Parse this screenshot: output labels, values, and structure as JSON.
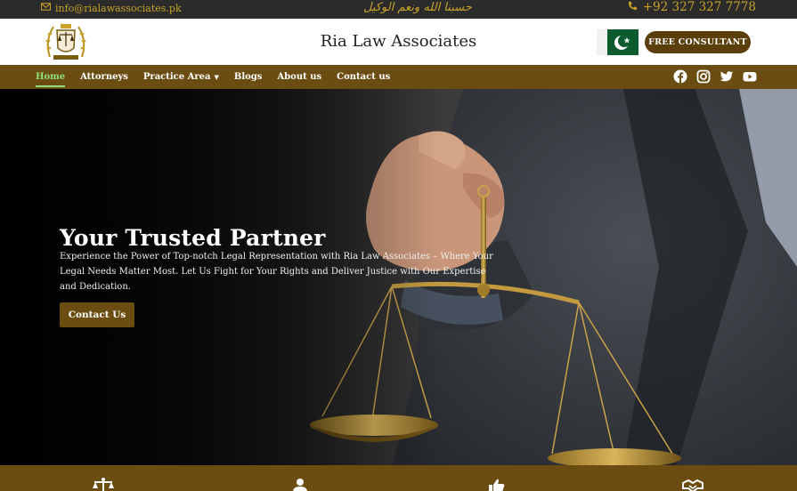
{
  "topbar": {
    "email": "info@rialawassociates.pk",
    "calligraphy": "حسبنا الله ونعم الوکیل",
    "phone": "+92 327 327 7778"
  },
  "header": {
    "brand": "Ria Law Associates",
    "cta": "FREE CONSULTANT",
    "flag": "pakistan-flag"
  },
  "nav": {
    "items": [
      {
        "label": "Home",
        "active": true
      },
      {
        "label": "Attorneys"
      },
      {
        "label": "Practice Area",
        "dropdown": true
      },
      {
        "label": "Blogs"
      },
      {
        "label": "About us"
      },
      {
        "label": "Contact us"
      }
    ],
    "social": [
      "facebook-icon",
      "instagram-icon",
      "twitter-icon",
      "youtube-icon"
    ]
  },
  "hero": {
    "title": "Your Trusted Partner",
    "subtitle": "Experience the Power of Top-notch Legal Representation with Ria Law Associates – Where Your Legal Needs Matter Most. Let Us Fight for Your Rights and Deliver Justice with Our Expertise and Dedication.",
    "cta": "Contact Us"
  },
  "colors": {
    "brand_brown": "#6b4d12",
    "gold": "#c9a227",
    "topbar": "#2b2b2b",
    "active_nav": "#8fe27a"
  },
  "strip_icons": [
    "scales-icon",
    "person-icon",
    "thumbs-up-icon",
    "handshake-icon"
  ]
}
